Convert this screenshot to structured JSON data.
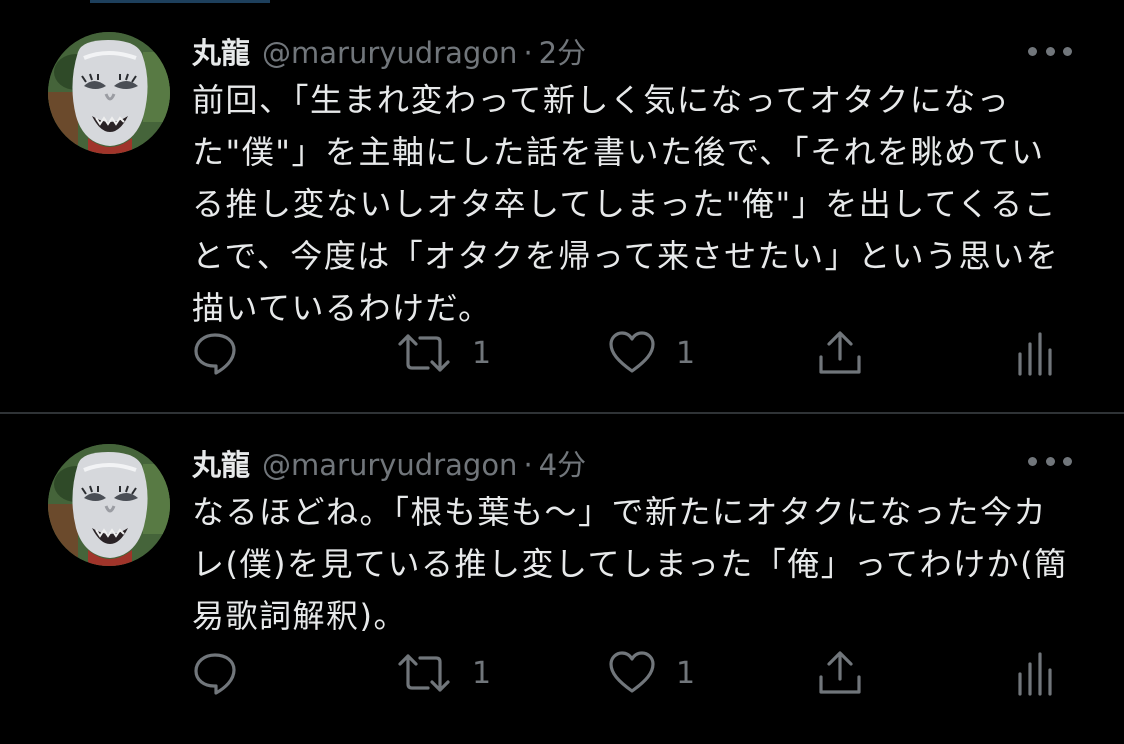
{
  "colors": {
    "background": "#000000",
    "text_primary": "#e7e9ea",
    "text_secondary": "#71767b",
    "divider": "#2f3336"
  },
  "tweets": [
    {
      "display_name": "丸龍",
      "handle": "@maruryudragon",
      "separator": "·",
      "timestamp": "2分",
      "avatar_icon": "avatar-mask-photo",
      "text_lines": [
        "前回、「生まれ変わって新しく気になってオタクになっ",
        "た\"僕\"」を主軸にした話を書いた後で、「それを眺めてい",
        "る推し変ないしオタ卒してしまった\"俺\"」を出してくるこ",
        "とで、今度は「オタクを帰って来させたい」という思いを",
        "描いているわけだ。"
      ],
      "replies": "",
      "retweets": "1",
      "likes": "1"
    },
    {
      "display_name": "丸龍",
      "handle": "@maruryudragon",
      "separator": "·",
      "timestamp": "4分",
      "avatar_icon": "avatar-mask-photo",
      "text_lines": [
        "なるほどね。「根も葉も〜」で新たにオタクになった今カ",
        "レ(僕)を見ている推し変してしまった「俺」ってわけか(簡",
        "易歌詞解釈)。"
      ],
      "replies": "",
      "retweets": "1",
      "likes": "1"
    }
  ],
  "icons": {
    "reply": "reply-icon",
    "retweet": "retweet-icon",
    "like": "heart-icon",
    "share": "share-icon",
    "analytics": "analytics-icon",
    "more": "more-icon"
  }
}
